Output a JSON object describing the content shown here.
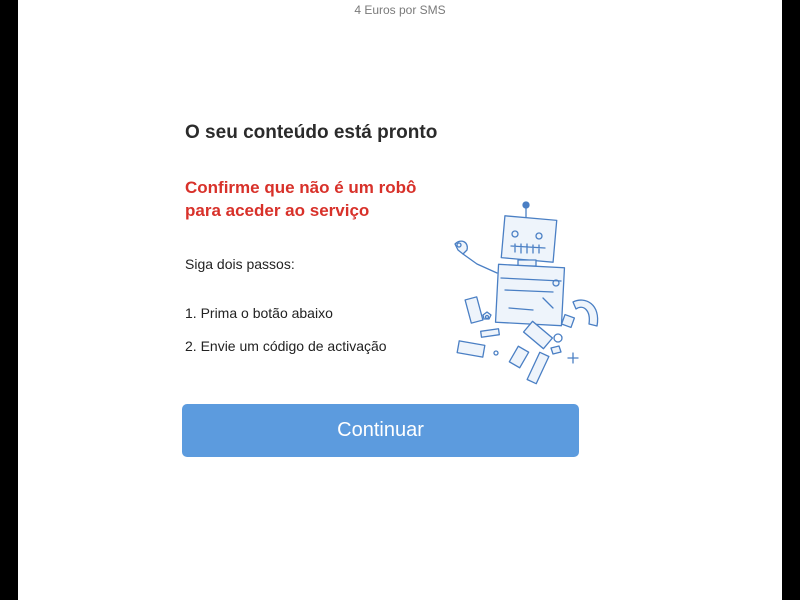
{
  "header": {
    "price_note": "4 Euros por SMS"
  },
  "main": {
    "heading": "O seu conteúdo está pronto",
    "warning_line1": "Confirme que não é um robô",
    "warning_line2": "para aceder ao serviço",
    "intro": "Siga dois passos:",
    "steps": [
      "1. Prima o botão abaixo",
      "2. Envie um código de activação"
    ],
    "illustration": "broken-robot-icon",
    "continue_label": "Continuar"
  },
  "colors": {
    "accent": "#5c9bde",
    "warning": "#d8312a",
    "text": "#2b2b2b",
    "background": "#ffffff",
    "frame": "#000000"
  }
}
